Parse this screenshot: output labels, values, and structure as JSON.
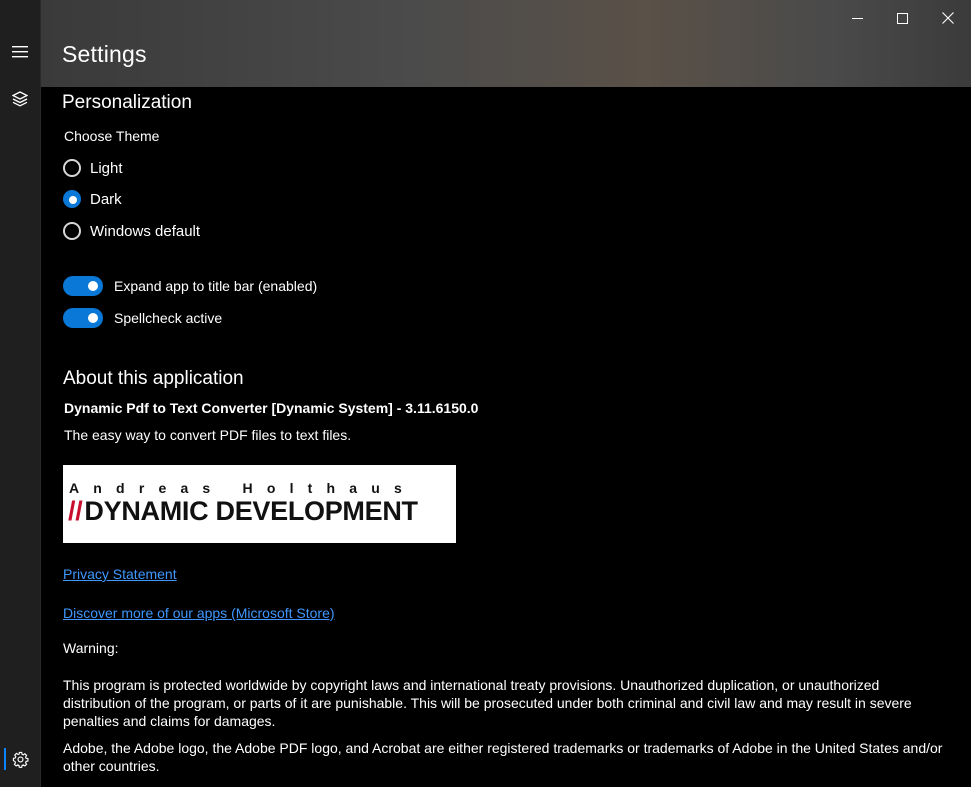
{
  "window": {
    "title": "Settings"
  },
  "personalization": {
    "heading": "Personalization",
    "theme_label": "Choose Theme",
    "themes": [
      {
        "label": "Light",
        "checked": false
      },
      {
        "label": "Dark",
        "checked": true
      },
      {
        "label": "Windows default",
        "checked": false
      }
    ],
    "toggles": [
      {
        "label": "Expand app to title bar (enabled)",
        "on": true
      },
      {
        "label": "Spellcheck active",
        "on": true
      }
    ]
  },
  "about": {
    "heading": "About this application",
    "app_name": "Dynamic Pdf to Text Converter [Dynamic System] - 3.11.6150.0",
    "tagline": "The easy way to convert PDF files to text files.",
    "logo_top": "Andreas Holthaus",
    "logo_slash": "//",
    "logo_bottom": "DYNAMIC DEVELOPMENT",
    "privacy_link": "Privacy Statement",
    "store_link": "Discover more of our apps (Microsoft Store)",
    "warning_label": "Warning:",
    "warning_text": "This program is protected worldwide by copyright laws and international treaty provisions. Unauthorized duplication, or unauthorized distribution of the program, or parts of it are punishable. This will be prosecuted under both criminal and civil law and may result in severe penalties and claims for damages.",
    "trademark_text": "Adobe, the Adobe logo, the Adobe PDF logo, and Acrobat are either registered trademarks or trademarks of Adobe in the United States and/or other countries."
  },
  "colors": {
    "accent": "#0a78d7",
    "link": "#3f98ff",
    "background": "#000000",
    "logo_slash": "#c8102e"
  }
}
